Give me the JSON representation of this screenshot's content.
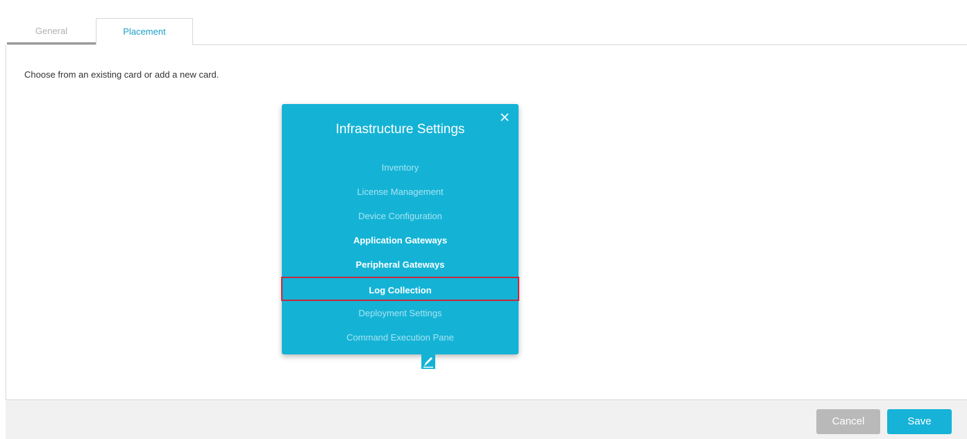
{
  "tabs": [
    {
      "label": "General",
      "active": false
    },
    {
      "label": "Placement",
      "active": true
    }
  ],
  "instructions": "Choose from an existing card or add a new card.",
  "card": {
    "title": "Infrastructure Settings",
    "close_icon": "close-icon",
    "color": "#14b3d6",
    "items": [
      {
        "label": "Inventory",
        "style": "dim"
      },
      {
        "label": "License Management",
        "style": "dim"
      },
      {
        "label": "Device Configuration",
        "style": "dim"
      },
      {
        "label": "Application Gateways",
        "style": "bold"
      },
      {
        "label": "Peripheral Gateways",
        "style": "bold"
      },
      {
        "label": "Log Collection",
        "style": "highlighted"
      },
      {
        "label": "Deployment Settings",
        "style": "dim"
      },
      {
        "label": "Command Execution Pane",
        "style": "dim"
      }
    ],
    "edit_icon": "pencil-icon"
  },
  "footer": {
    "cancel_label": "Cancel",
    "save_label": "Save"
  },
  "colors": {
    "accent": "#16b2d8",
    "highlight_border": "#c8283c",
    "cancel_bg": "#b9b9b9"
  }
}
